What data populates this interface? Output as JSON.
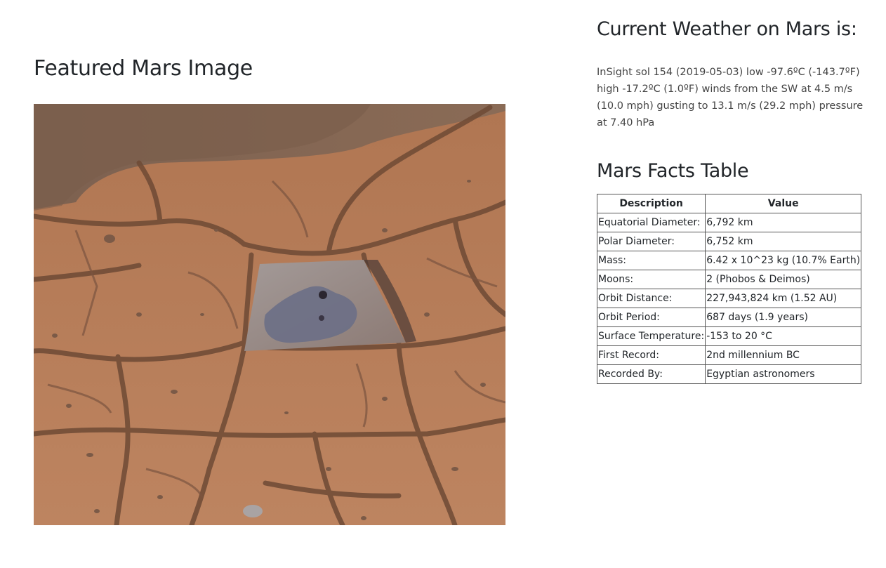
{
  "featured": {
    "title": "Featured Mars Image"
  },
  "weather": {
    "title": "Current Weather on Mars is:",
    "report": "InSight sol 154 (2019-05-03) low -97.6ºC (-143.7ºF) high -17.2ºC (1.0ºF) winds from the SW at 4.5 m/s (10.0 mph) gusting to 13.1 m/s (29.2 mph) pressure at 7.40 hPa"
  },
  "facts": {
    "title": "Mars Facts Table",
    "headers": [
      "Description",
      "Value"
    ],
    "rows": [
      [
        "Equatorial Diameter:",
        "6,792 km"
      ],
      [
        "Polar Diameter:",
        "6,752 km"
      ],
      [
        "Mass:",
        "6.42 x 10^23 kg (10.7% Earth)"
      ],
      [
        "Moons:",
        "2 (Phobos & Deimos)"
      ],
      [
        "Orbit Distance:",
        "227,943,824 km (1.52 AU)"
      ],
      [
        "Orbit Period:",
        "687 days (1.9 years)"
      ],
      [
        "Surface Temperature:",
        "-153 to 20 °C"
      ],
      [
        "First Record:",
        "2nd millennium BC"
      ],
      [
        "Recorded By:",
        "Egyptian astronomers"
      ]
    ]
  },
  "colors": {
    "mars_surface": "#b87a52",
    "mars_crack": "#6e4a35",
    "mars_sand": "#8a6a52",
    "drilled_rock": "#6c6f86"
  }
}
